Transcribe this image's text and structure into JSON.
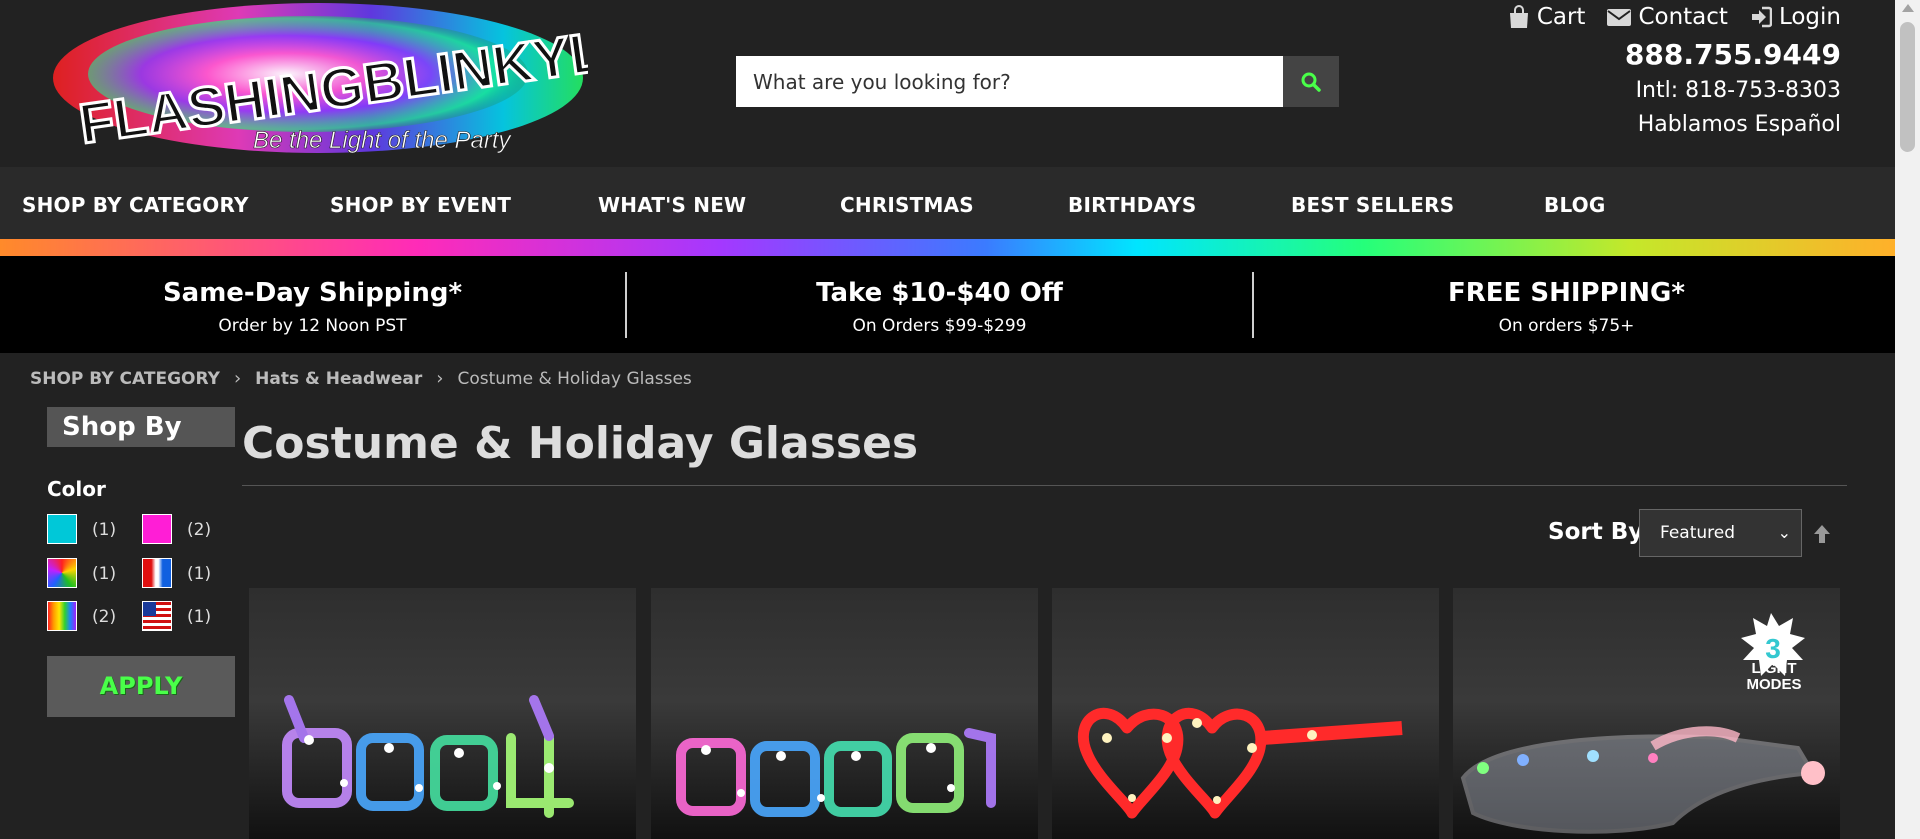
{
  "header": {
    "logo_text": "FLASHINGBLINKYLIGHTS",
    "logo_tagline": "Be the Light of the Party",
    "search_placeholder": "What are you looking for?",
    "links": {
      "cart": "Cart",
      "contact": "Contact",
      "login": "Login"
    },
    "phone": "888.755.9449",
    "intl_phone": "Intl: 818-753-8303",
    "spanish": "Hablamos Español"
  },
  "nav": {
    "items": [
      "SHOP BY CATEGORY",
      "SHOP BY EVENT",
      "WHAT'S NEW",
      "CHRISTMAS",
      "BIRTHDAYS",
      "BEST SELLERS",
      "BLOG"
    ]
  },
  "promo": [
    {
      "title": "Same-Day Shipping*",
      "sub": "Order by 12 Noon PST"
    },
    {
      "title": "Take $10-$40 Off",
      "sub": "On Orders $99-$299"
    },
    {
      "title": "FREE SHIPPING*",
      "sub": "On orders $75+"
    }
  ],
  "breadcrumb": [
    "SHOP BY CATEGORY",
    "Hats & Headwear",
    "Costume & Holiday Glasses"
  ],
  "sidebar": {
    "title": "Shop By",
    "color_label": "Color",
    "swatches": [
      {
        "color": "#00c8d8",
        "count": "(1)"
      },
      {
        "color": "#ff1ed6",
        "count": "(2)"
      },
      {
        "color": "multicolor",
        "count": "(1)"
      },
      {
        "color": "red-white-blue",
        "count": "(1)"
      },
      {
        "color": "rainbow",
        "count": "(2)"
      },
      {
        "color": "usa-flag",
        "count": "(1)"
      }
    ],
    "apply_label": "APPLY"
  },
  "main": {
    "title": "Costume & Holiday Glasses",
    "sort_label": "Sort By",
    "sort_value": "Featured",
    "products": [
      {
        "image": "2024-led-glasses"
      },
      {
        "image": "2023-led-glasses"
      },
      {
        "image": "red-heart-led-glasses"
      },
      {
        "image": "clear-led-visor-glasses",
        "badge_number": "3",
        "badge_text": "LIGHT MODES"
      }
    ]
  },
  "colors": {
    "accent_green": "#49ff49",
    "background": "#222222",
    "promo_bg": "#000000"
  }
}
